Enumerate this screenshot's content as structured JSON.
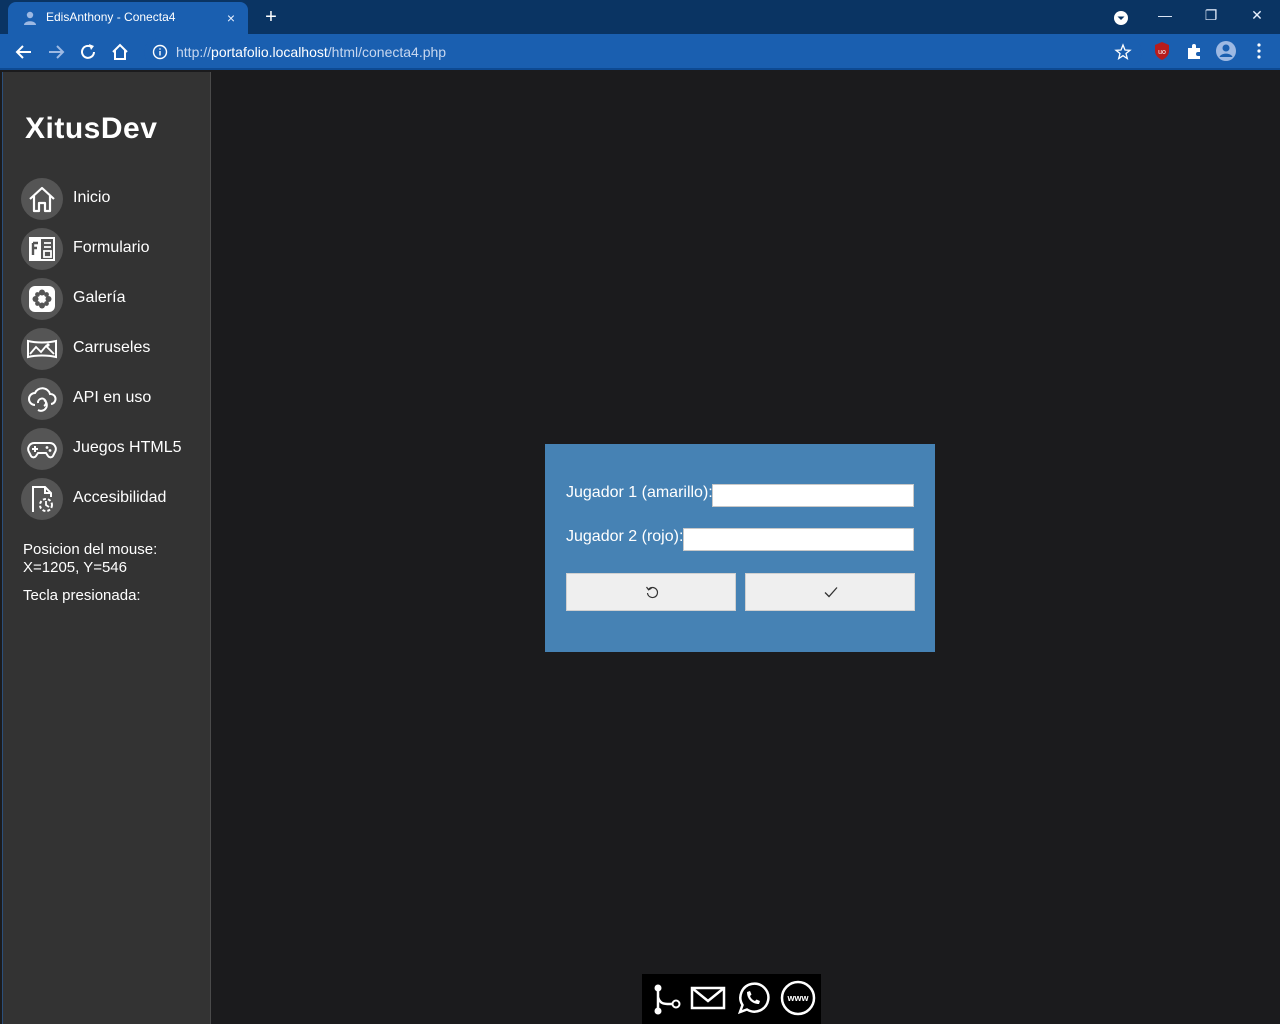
{
  "browser": {
    "tab_title": "EdisAnthony - Conecta4",
    "tab_close": "×",
    "new_tab": "+",
    "url_prefix": "http://",
    "url_host": "portafolio.localhost",
    "url_path": "/html/conecta4.php",
    "window_minimize": "—",
    "window_restore": "❐",
    "window_close": "✕"
  },
  "sidebar": {
    "brand": "XitusDev",
    "items": [
      {
        "label": "Inicio",
        "icon": "home-icon"
      },
      {
        "label": "Formulario",
        "icon": "form-icon"
      },
      {
        "label": "Galería",
        "icon": "gallery-icon"
      },
      {
        "label": "Carruseles",
        "icon": "carousel-icon"
      },
      {
        "label": "API en uso",
        "icon": "api-cloud-icon"
      },
      {
        "label": "Juegos HTML5",
        "icon": "gamepad-icon"
      },
      {
        "label": "Accesibilidad",
        "icon": "accessibility-icon"
      }
    ],
    "mouse_label": "Posicion del mouse:",
    "mouse_value": "X=1205, Y=546",
    "key_label": "Tecla presionada:"
  },
  "dialog": {
    "player1_label": "Jugador 1 (amarillo):",
    "player1_value": "",
    "player2_label": "Jugador 2 (rojo):",
    "player2_value": "",
    "reset_icon": "reset-icon",
    "confirm_icon": "check-icon"
  },
  "footer": {
    "icons": [
      "git-icon",
      "mail-icon",
      "whatsapp-icon",
      "www-icon"
    ]
  },
  "colors": {
    "chrome_dark": "#0a3463",
    "chrome_tab": "#1a5fb0",
    "sidebar": "#333333",
    "background": "#1b1b1d",
    "dialog": "#4682b4"
  }
}
